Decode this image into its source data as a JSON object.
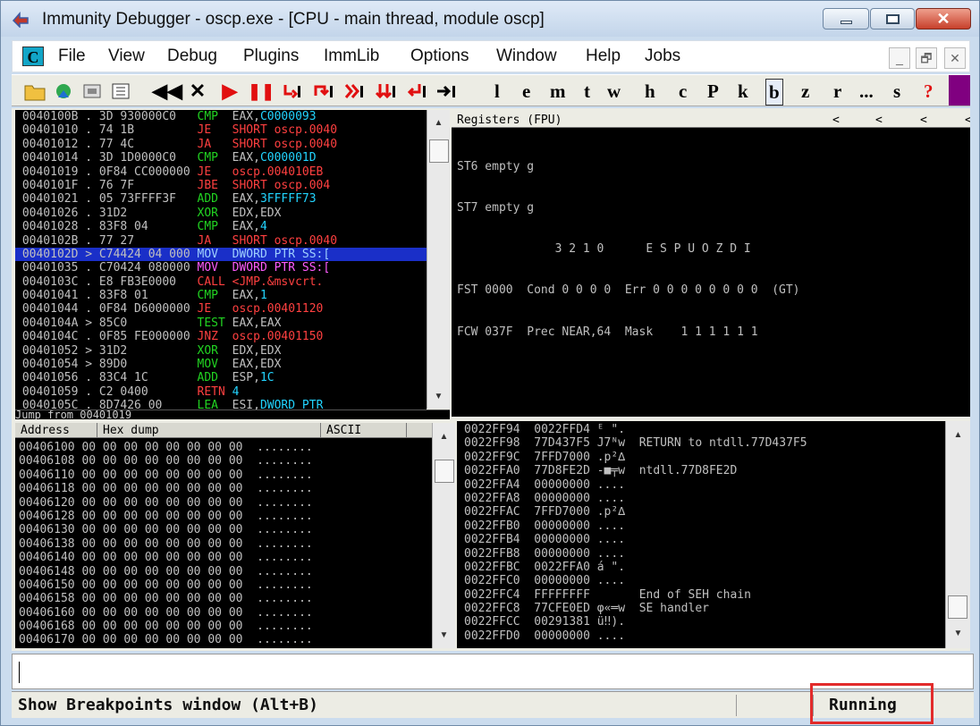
{
  "window": {
    "title": "Immunity Debugger - oscp.exe - [CPU - main thread, module oscp]",
    "close_glyph": "✕"
  },
  "menubar": {
    "icon_letter": "C",
    "items": [
      "File",
      "View",
      "Debug",
      "Plugins",
      "ImmLib",
      "Options",
      "Window",
      "Help",
      "Jobs"
    ],
    "mdi_buttons": [
      "_",
      "🗗",
      "✕"
    ]
  },
  "toolbar": {
    "glyph_buttons": [
      "◀◀",
      "✕",
      "▶",
      "❚❚"
    ],
    "letters": [
      "l",
      "e",
      "m",
      "t",
      "w",
      "h",
      "c",
      "P",
      "k",
      "b",
      "z",
      "r",
      "...",
      "s",
      "?"
    ],
    "selected_letter": "b",
    "colors": {
      "run": "#e11010",
      "step": "#e11010",
      "accent": "#800080"
    }
  },
  "disasm": {
    "rows": [
      {
        "addr": "0040100B",
        "mark": ".",
        "hex": "3D 930000C0",
        "mn": "CMP",
        "cls": "k-cmp",
        "args": "EAX,C0000093"
      },
      {
        "addr": "00401010",
        "mark": ".",
        "hex": "74 1B",
        "mn": "JE",
        "cls": "k-jmp",
        "args": "SHORT oscp.0040"
      },
      {
        "addr": "00401012",
        "mark": ".",
        "hex": "77 4C",
        "mn": "JA",
        "cls": "k-jmp",
        "args": "SHORT oscp.0040"
      },
      {
        "addr": "00401014",
        "mark": ".",
        "hex": "3D 1D0000C0",
        "mn": "CMP",
        "cls": "k-cmp",
        "args": "EAX,C000001D"
      },
      {
        "addr": "00401019",
        "mark": ".",
        "hex": "0F84 CC000000",
        "mn": "JE",
        "cls": "k-jmp",
        "args": "oscp.004010EB"
      },
      {
        "addr": "0040101F",
        "mark": ".",
        "hex": "76 7F",
        "mn": "JBE",
        "cls": "k-jmp",
        "args": "SHORT oscp.004"
      },
      {
        "addr": "00401021",
        "mark": ".",
        "hex": "05 73FFFF3F",
        "mn": "ADD",
        "cls": "k-add",
        "args": "EAX,3FFFFF73"
      },
      {
        "addr": "00401026",
        "mark": ".",
        "hex": "31D2",
        "mn": "XOR",
        "cls": "k-xor",
        "args": "EDX,EDX"
      },
      {
        "addr": "00401028",
        "mark": ".",
        "hex": "83F8 04",
        "mn": "CMP",
        "cls": "k-cmp",
        "args": "EAX,4"
      },
      {
        "addr": "0040102B",
        "mark": ".",
        "hex": "77 27",
        "mn": "JA",
        "cls": "k-jmp",
        "args": "SHORT oscp.0040"
      },
      {
        "addr": "0040102D",
        "mark": ">",
        "hex": "C74424 04 000",
        "mn": "MOV",
        "cls": "k-mov",
        "args": "DWORD PTR SS:[",
        "hl": true
      },
      {
        "addr": "00401035",
        "mark": ".",
        "hex": "C70424 080000",
        "mn": "MOV",
        "cls": "k-mov",
        "args": "DWORD PTR SS:["
      },
      {
        "addr": "0040103C",
        "mark": ".",
        "hex": "E8 FB3E0000",
        "mn": "CALL",
        "cls": "k-call",
        "args": "<JMP.&msvcrt."
      },
      {
        "addr": "00401041",
        "mark": ".",
        "hex": "83F8 01",
        "mn": "CMP",
        "cls": "k-cmp",
        "args": "EAX,1"
      },
      {
        "addr": "00401044",
        "mark": ".",
        "hex": "0F84 D6000000",
        "mn": "JE",
        "cls": "k-jmp",
        "args": "oscp.00401120"
      },
      {
        "addr": "0040104A",
        "mark": ">",
        "hex": "85C0",
        "mn": "TEST",
        "cls": "k-test",
        "args": "EAX,EAX"
      },
      {
        "addr": "0040104C",
        "mark": ".",
        "hex": "0F85 FE000000",
        "mn": "JNZ",
        "cls": "k-jmp",
        "args": "oscp.00401150"
      },
      {
        "addr": "00401052",
        "mark": ">",
        "hex": "31D2",
        "mn": "XOR",
        "cls": "k-xor",
        "args": "EDX,EDX"
      },
      {
        "addr": "00401054",
        "mark": ">",
        "hex": "89D0",
        "mn": "MOV",
        "cls": "k-xor",
        "args": "EAX,EDX"
      },
      {
        "addr": "00401056",
        "mark": ".",
        "hex": "83C4 1C",
        "mn": "ADD",
        "cls": "k-add",
        "args": "ESP,1C"
      },
      {
        "addr": "00401059",
        "mark": ".",
        "hex": "C2 0400",
        "mn": "RETN",
        "cls": "k-retn",
        "args": "4"
      },
      {
        "addr": "0040105C",
        "mark": ".",
        "hex": "8D7426 00",
        "mn": "LEA",
        "cls": "k-add",
        "args": "ESI,DWORD PTR"
      }
    ],
    "info_line": "Jump from 00401019"
  },
  "registers": {
    "header": "Registers (FPU)",
    "nav": [
      "<",
      "<",
      "<",
      "<"
    ],
    "lines": [
      "ST6 empty g",
      "ST7 empty g",
      "              3 2 1 0      E S P U O Z D I",
      "FST 0000  Cond 0 0 0 0  Err 0 0 0 0 0 0 0 0  (GT)",
      "FCW 037F  Prec NEAR,64  Mask    1 1 1 1 1 1"
    ]
  },
  "dump": {
    "headers": [
      "Address",
      "Hex dump",
      "ASCII"
    ],
    "rows": [
      [
        "00406100",
        "00 00 00 00 00 00 00 00",
        "........"
      ],
      [
        "00406108",
        "00 00 00 00 00 00 00 00",
        "........"
      ],
      [
        "00406110",
        "00 00 00 00 00 00 00 00",
        "........"
      ],
      [
        "00406118",
        "00 00 00 00 00 00 00 00",
        "........"
      ],
      [
        "00406120",
        "00 00 00 00 00 00 00 00",
        "........"
      ],
      [
        "00406128",
        "00 00 00 00 00 00 00 00",
        "........"
      ],
      [
        "00406130",
        "00 00 00 00 00 00 00 00",
        "........"
      ],
      [
        "00406138",
        "00 00 00 00 00 00 00 00",
        "........"
      ],
      [
        "00406140",
        "00 00 00 00 00 00 00 00",
        "........"
      ],
      [
        "00406148",
        "00 00 00 00 00 00 00 00",
        "........"
      ],
      [
        "00406150",
        "00 00 00 00 00 00 00 00",
        "........"
      ],
      [
        "00406158",
        "00 00 00 00 00 00 00 00",
        "........"
      ],
      [
        "00406160",
        "00 00 00 00 00 00 00 00",
        "........"
      ],
      [
        "00406168",
        "00 00 00 00 00 00 00 00",
        "........"
      ],
      [
        "00406170",
        "00 00 00 00 00 00 00 00",
        "........"
      ]
    ]
  },
  "stack": {
    "rows": [
      [
        "0022FF94",
        "0022FFD4",
        "ᴱ \".",
        ""
      ],
      [
        "0022FF98",
        "77D437F5",
        "J7ᴺw",
        "RETURN to ntdll.77D437F5"
      ],
      [
        "0022FF9C",
        "7FFD7000",
        ".p²∆",
        ""
      ],
      [
        "0022FFA0",
        "77D8FE2D",
        "-■╤w",
        "ntdll.77D8FE2D"
      ],
      [
        "0022FFA4",
        "00000000",
        "....",
        ""
      ],
      [
        "0022FFA8",
        "00000000",
        "....",
        ""
      ],
      [
        "0022FFAC",
        "7FFD7000",
        ".p²∆",
        ""
      ],
      [
        "0022FFB0",
        "00000000",
        "....",
        ""
      ],
      [
        "0022FFB4",
        "00000000",
        "....",
        ""
      ],
      [
        "0022FFB8",
        "00000000",
        "....",
        ""
      ],
      [
        "0022FFBC",
        "0022FFA0",
        "á \".",
        ""
      ],
      [
        "0022FFC0",
        "00000000",
        "....",
        ""
      ],
      [
        "0022FFC4",
        "FFFFFFFF",
        "",
        "End of SEH chain"
      ],
      [
        "0022FFC8",
        "77CFE0ED",
        "φ«═w",
        "SE handler"
      ],
      [
        "0022FFCC",
        "00291381",
        "ü‼).",
        ""
      ],
      [
        "0022FFD0",
        "00000000",
        "....",
        ""
      ]
    ]
  },
  "status": {
    "text": "Show Breakpoints window (Alt+B)",
    "state": "Running",
    "highlight_color": "#e22b2b"
  },
  "scroll": {
    "up": "▲",
    "down": "▼"
  }
}
